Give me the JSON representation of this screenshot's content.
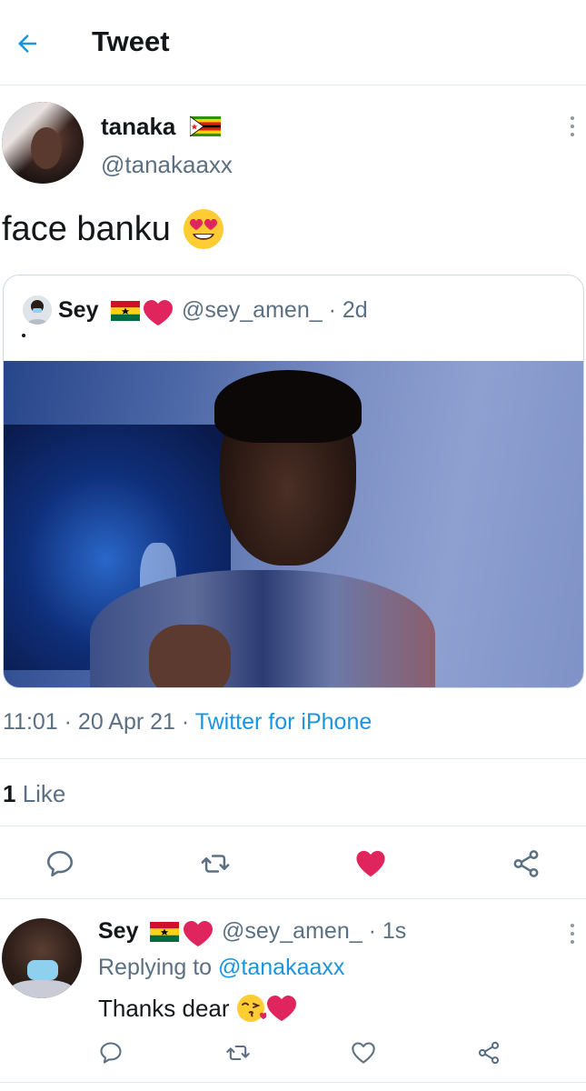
{
  "header": {
    "title": "Tweet",
    "back_icon": "arrow-left-icon"
  },
  "tweet": {
    "author_name": "tanaka",
    "author_handle": "@tanakaaxx",
    "text": "face banku",
    "emoji": "heart-eyes-emoji",
    "timestamp": "11:01 · 20 Apr 21 · ",
    "source": "Twitter for iPhone",
    "likes_count": "1",
    "likes_label": " Like",
    "liked": true
  },
  "quote": {
    "author_name": "Sey",
    "author_handle": "@sey_amen_ · 2d",
    "text_dot": "."
  },
  "reply": {
    "author_name": "Sey",
    "author_handle": "@sey_amen_ · 1s",
    "replying_label": "Replying to ",
    "replying_mention": "@tanakaaxx",
    "text": "Thanks dear"
  },
  "colors": {
    "accent": "#1b95e0",
    "like_red": "#e0245e",
    "muted": "#5b7083",
    "divider": "#e1e8ed"
  }
}
